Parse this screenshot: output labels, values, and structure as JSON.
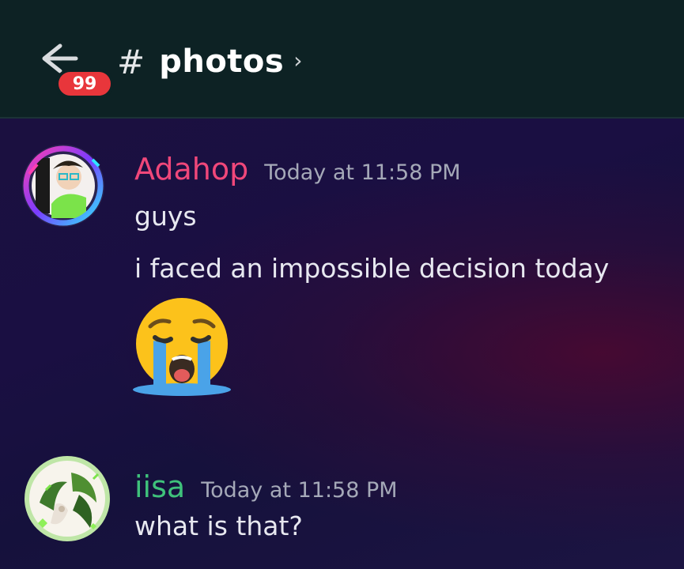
{
  "header": {
    "back_badge": "99",
    "channel_hash": "#",
    "channel_name": "photos",
    "chevron": "›",
    "colors": {
      "background": "#0d2224",
      "badge": "#e8363b"
    }
  },
  "icons": {
    "back": "arrow-left-icon",
    "chevron": "chevron-right-icon",
    "emoji": "loudly-crying-face-icon"
  },
  "messages": [
    {
      "username": "Adahop",
      "username_color": "#f0477a",
      "timestamp": "Today at 11:58 PM",
      "lines": [
        "guys",
        "i faced an impossible decision today"
      ],
      "emoji": "loudly-crying-face"
    },
    {
      "username": "iisa",
      "username_color": "#3fc27b",
      "timestamp": "Today at 11:58 PM",
      "lines": [
        "what is that?"
      ]
    }
  ]
}
